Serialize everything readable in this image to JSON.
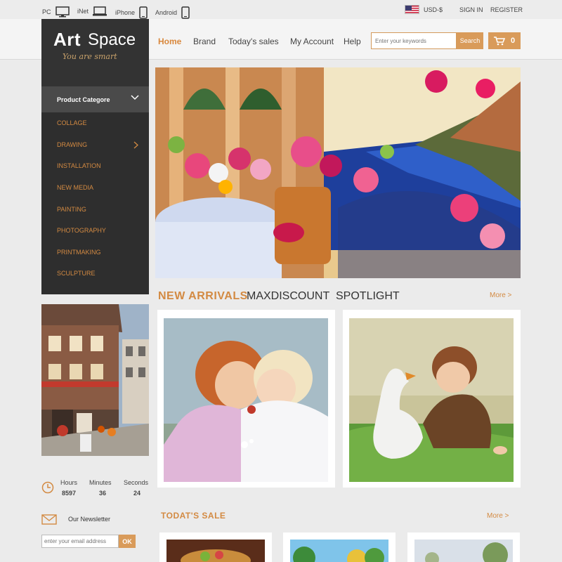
{
  "topbar": {
    "devices": [
      {
        "label": "PC",
        "icon": "monitor-icon"
      },
      {
        "label": "iNet",
        "icon": "laptop-icon"
      },
      {
        "label": "iPhone",
        "icon": "phone-icon"
      },
      {
        "label": "Android",
        "icon": "android-phone-icon"
      }
    ],
    "currency": "USD-$",
    "sign_in": "SIGN IN",
    "register": "REGISTER"
  },
  "logo": {
    "word1": "Art",
    "word2": "Space",
    "tagline": "You are smart"
  },
  "nav": [
    "Home",
    "Brand",
    "Today's sales",
    "My Account",
    "Help"
  ],
  "search": {
    "placeholder": "Enter your keywords",
    "button": "Search"
  },
  "cart": {
    "count": "0"
  },
  "sidebar": {
    "header": "Product  Categore",
    "items": [
      "COLLAGE",
      "DRAWING",
      "INSTALLATION",
      "NEW MEDIA",
      "PAINTING",
      "PHOTOGRAPHY",
      "PRINTMAKING",
      "SCULPTURE"
    ]
  },
  "timer": {
    "hours_label": "Hours",
    "hours": "8597",
    "minutes_label": "Minutes",
    "minutes": "36",
    "seconds_label": "Seconds",
    "seconds": "24"
  },
  "newsletter": {
    "label": "Our  Newsletter",
    "placeholder": "enter your email address",
    "button": "OK"
  },
  "tabs": [
    "NEW  ARRIVALS",
    "MAXDISCOUNT",
    "SPOTLIGHT"
  ],
  "more_label": "More  >",
  "sale": {
    "title": "TODAT'S  SALE",
    "more": "More  >"
  },
  "colors": {
    "accent": "#d99b5a",
    "accent_text": "#d38a42",
    "sidebar_bg": "#2e2e2e"
  }
}
